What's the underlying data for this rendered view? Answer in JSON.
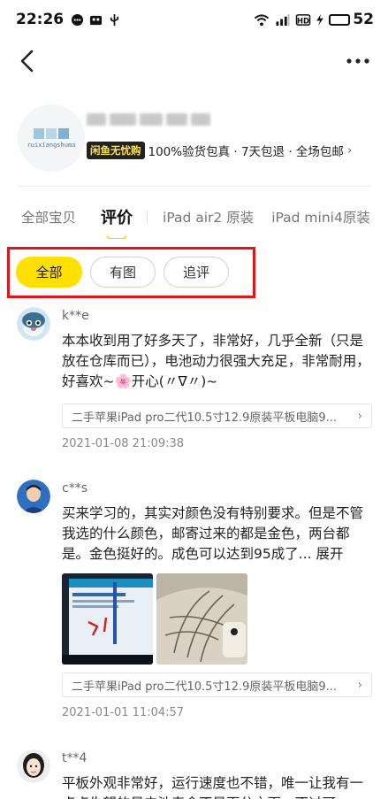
{
  "status_bar": {
    "time": "22:26",
    "battery_level": "52"
  },
  "shop": {
    "logo_text": "ruixiangshuma",
    "badge": "闲鱼无忧购",
    "tagline": "100%验货包真 · 7天包退 · 全场包邮"
  },
  "tabs": [
    {
      "label": "全部宝贝"
    },
    {
      "label": "评价"
    },
    {
      "label": "iPad air2 原装"
    },
    {
      "label": "iPad mini4原装"
    }
  ],
  "filters": [
    {
      "label": "全部"
    },
    {
      "label": "有图"
    },
    {
      "label": "追评"
    }
  ],
  "reviews": [
    {
      "user": "k**e",
      "content": "本本收到用了好多天了，非常好，几乎全新（只是放在仓库而已），电池动力很强大充足，非常耐用，好喜欢~🌸开心(〃∇〃)~",
      "product": "二手苹果iPad pro二代10.5寸12.9原装平板电脑9...",
      "date": "2021-01-08 21:09:38"
    },
    {
      "user": "c**s",
      "content": "买来学习的，其实对颜色没有特别要求。但是不管我选的什么颜色，邮寄过来的都是金色，两台都是。金色挺好的。成色可以达到95成了...",
      "expand": "展开",
      "product": "二手苹果iPad pro二代10.5寸12.9原装平板电脑9...",
      "date": "2021-01-01 11:04:57"
    },
    {
      "user": "t**4",
      "content": "平板外观非常好，运行速度也不错，唯一让我有一点点失望的是电池寿命不是百分之百，不过可"
    }
  ],
  "colors": {
    "accent": "#ffe000",
    "highlight_box": "#e4141b"
  }
}
